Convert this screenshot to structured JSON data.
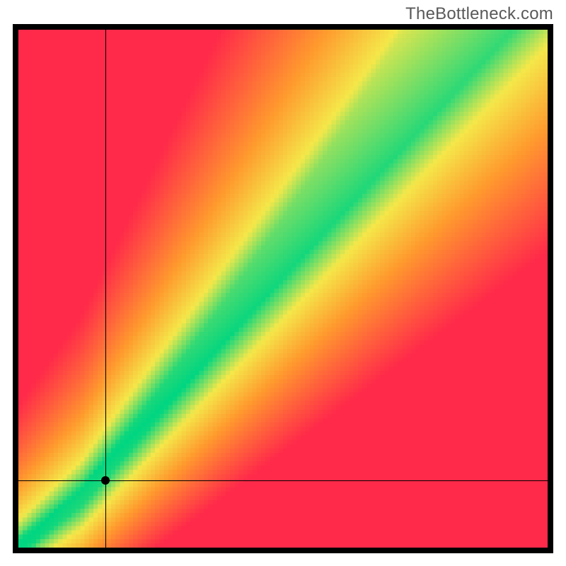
{
  "watermark": "TheBottleneck.com",
  "chart_data": {
    "type": "heatmap",
    "title": "",
    "xlabel": "",
    "ylabel": "",
    "xlim": [
      0,
      100
    ],
    "ylim": [
      0,
      100
    ],
    "description": "Bottleneck heatmap: green diagonal band indicates balanced pairing; red and yellow regions indicate bottleneck in one component.",
    "optimal_band": {
      "slope_above_kink": 1.2,
      "slope_below_kink": 0.85,
      "kink_x": 12,
      "kink_y": 10,
      "width_start_pct": 2,
      "width_end_pct": 13
    },
    "crosshair": {
      "x": 16.5,
      "y": 13
    },
    "marker": {
      "x": 16.5,
      "y": 13
    },
    "colors": {
      "good": "#00d681",
      "mid": "#f5e84a",
      "warn": "#ff9a2e",
      "bad": "#ff2a4a"
    },
    "grid_size": 120
  }
}
